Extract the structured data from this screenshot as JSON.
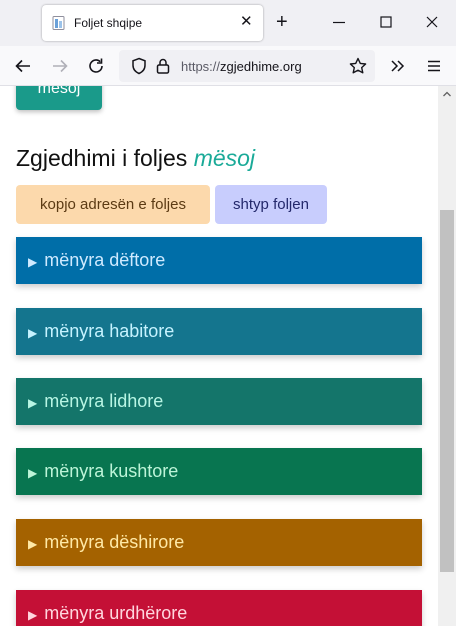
{
  "browser": {
    "tab_title": "Foljet shqipe",
    "url_scheme": "https://",
    "url_host": "zgjedhime.org"
  },
  "page": {
    "verb_button_label": "mësoj",
    "heading_prefix": "Zgjedhimi i foljes",
    "heading_verb": "mësoj",
    "copy_button_label": "kopjo adresën e foljes",
    "print_button_label": "shtyp foljen",
    "moods": [
      {
        "label": "mënyra dëftore",
        "bg": "#006ea8",
        "fg": "#cfeaff"
      },
      {
        "label": "mënyra habitore",
        "bg": "#14758e",
        "fg": "#c6f3ff"
      },
      {
        "label": "mënyra lidhore",
        "bg": "#14756a",
        "fg": "#b8f5e4"
      },
      {
        "label": "mënyra kushtore",
        "bg": "#087550",
        "fg": "#bdf4d8"
      },
      {
        "label": "mënyra dëshirore",
        "bg": "#a46200",
        "fg": "#ffe9a6"
      },
      {
        "label": "mënyra urdhërore",
        "bg": "#c41036",
        "fg": "#ffd6de"
      }
    ]
  },
  "icons": {
    "favicon": "page-icon",
    "back": "arrow-left-icon",
    "forward": "arrow-right-icon",
    "reload": "reload-icon",
    "shield": "shield-icon",
    "lock": "lock-icon",
    "bookmark": "star-icon",
    "overflow": "chevron-double-right-icon",
    "menu": "hamburger-menu-icon"
  }
}
